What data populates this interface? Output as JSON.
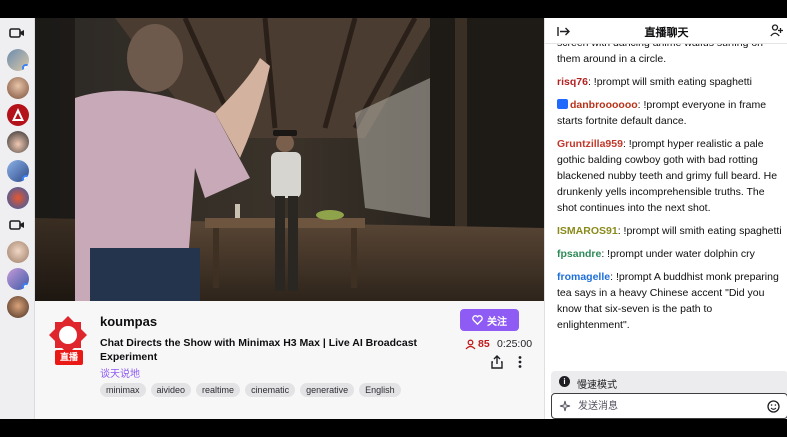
{
  "channel": {
    "name": "koumpas",
    "live_badge": "直播",
    "title": "Chat Directs the Show with Minimax H3 Max | Live AI Broadcast Experiment",
    "category": "谈天说地",
    "tags": [
      "minimax",
      "aivideo",
      "realtime",
      "cinematic",
      "generative",
      "English"
    ],
    "follow_label": "关注",
    "viewers": "85",
    "uptime": "0:25:00"
  },
  "chat": {
    "title": "直播聊天",
    "slow_mode_label": "慢速模式",
    "input_placeholder": "发送消息",
    "messages": [
      {
        "user": "",
        "color": "#0e0e10",
        "text": "screen with dancing anime waifus surfing on them around in a circle.",
        "badge": false
      },
      {
        "user": "risq76",
        "color": "#b22222",
        "text": " !prompt will smith eating spaghetti",
        "badge": false
      },
      {
        "user": "danbroooooo",
        "color": "#b8321a",
        "text": " !prompt everyone in frame starts fortnite default dance.",
        "badge": true
      },
      {
        "user": "Gruntzilla959",
        "color": "#c0392b",
        "text": " !prompt hyper realistic a pale gothic balding cowboy goth with bad rotting blackened nubby teeth and grimy full beard. He drunkenly yells incomprehensible truths. The shot continues into the next shot.",
        "badge": false
      },
      {
        "user": "ISMAROS91",
        "color": "#8a8a1a",
        "text": " !prompt will smith eating spaghetti",
        "badge": false
      },
      {
        "user": "fpsandre",
        "color": "#2e8b57",
        "text": " !prompt under water dolphin cry",
        "badge": false
      },
      {
        "user": "fromagelle",
        "color": "#1e6fd9",
        "text": " !prompt A buddhist monk preparing tea says in a heavy Chinese accent \"Did you know that six-seven is the path to enlightenment\".",
        "badge": false
      }
    ]
  },
  "colors": {
    "accent": "#8e5cf4",
    "live_red": "#e91916",
    "viewer_red": "#c11a1a"
  },
  "icons": {
    "sidebar": [
      "video-camera-icon",
      "video-camera-icon"
    ],
    "follow": "heart-icon",
    "viewers": "person-icon",
    "share": "share-icon",
    "more": "more-vertical-icon",
    "chat_collapse": "collapse-right-icon",
    "chat_users": "community-icon",
    "slow_mode": "info-icon",
    "input": "sparkle-icon",
    "emoji": "emoji-smile-icon"
  }
}
